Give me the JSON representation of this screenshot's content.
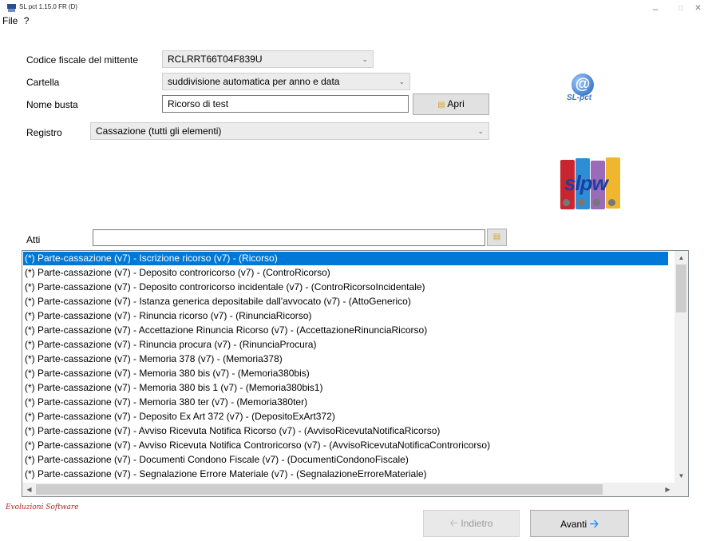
{
  "window": {
    "title": "SL pct 1.15.0 FR (D)",
    "minimize_glyph": "–",
    "maximize_glyph": "□",
    "close_glyph": "✕"
  },
  "menu": [
    {
      "label": "File"
    },
    {
      "label": "?"
    }
  ],
  "form": {
    "codice_label": "Codice fiscale del mittente",
    "codice_value": "RCLRRT66T04F839U",
    "cartella_label": "Cartella",
    "cartella_value": "suddivisione automatica per anno e data",
    "nome_label": "Nome busta",
    "nome_value": "Ricorso di test",
    "apri_label": "Apri",
    "registro_label": "Registro",
    "registro_value": "Cassazione (tutti gli elementi)",
    "atti_label": "Atti",
    "atti_filter_value": ""
  },
  "logos": {
    "slpct_text": "SL-pct",
    "slpct_at": "@",
    "binders_text": "slpw"
  },
  "atti_list": [
    "(*) Parte-cassazione (v7) - Iscrizione ricorso (v7) - (Ricorso)",
    "(*) Parte-cassazione (v7) - Deposito controricorso (v7) - (ControRicorso)",
    "(*) Parte-cassazione (v7) - Deposito controricorso incidentale (v7) - (ControRicorsoIncidentale)",
    "(*) Parte-cassazione (v7) - Istanza generica depositabile dall'avvocato (v7) - (AttoGenerico)",
    "(*) Parte-cassazione (v7) - Rinuncia ricorso (v7) - (RinunciaRicorso)",
    "(*) Parte-cassazione (v7) - Accettazione Rinuncia Ricorso (v7) - (AccettazioneRinunciaRicorso)",
    "(*) Parte-cassazione (v7) - Rinuncia procura (v7) - (RinunciaProcura)",
    "(*) Parte-cassazione (v7) - Memoria 378 (v7) - (Memoria378)",
    "(*) Parte-cassazione (v7) - Memoria 380 bis (v7) - (Memoria380bis)",
    "(*) Parte-cassazione (v7) - Memoria 380 bis 1 (v7) - (Memoria380bis1)",
    "(*) Parte-cassazione (v7) - Memoria 380 ter (v7) - (Memoria380ter)",
    "(*) Parte-cassazione (v7) - Deposito Ex Art 372 (v7) - (DepositoExArt372)",
    "(*) Parte-cassazione (v7) - Avviso Ricevuta Notifica Ricorso (v7) - (AvvisoRicevutaNotificaRicorso)",
    "(*) Parte-cassazione (v7) - Avviso Ricevuta Notifica Controricorso (v7) - (AvvisoRicevutaNotificaControricorso)",
    "(*) Parte-cassazione (v7) - Documenti Condono Fiscale (v7) - (DocumentiCondonoFiscale)",
    "(*) Parte-cassazione (v7) - Segnalazione Errore Materiale (v7) - (SegnalazioneErroreMateriale)"
  ],
  "footer": {
    "brand": "Evoluzioni Software",
    "back_label": "Indietro",
    "next_label": "Avanti"
  },
  "colors": {
    "selection": "#0078d7",
    "accent_arrow": "#1e90ff",
    "brand_red": "#b22222"
  }
}
